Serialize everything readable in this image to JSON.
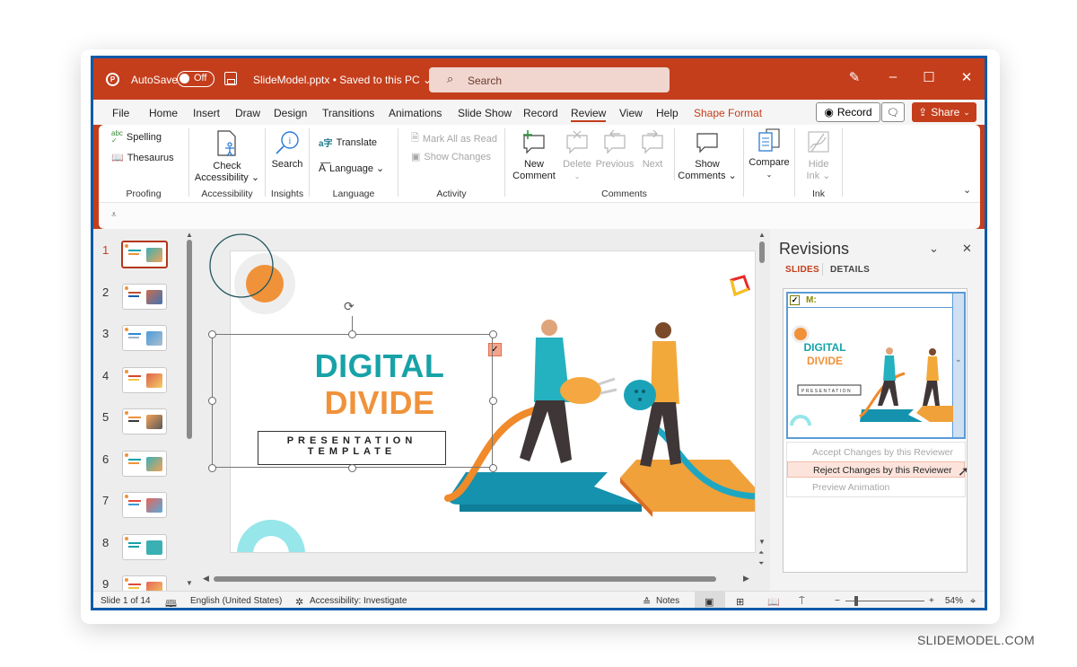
{
  "titlebar": {
    "autosave_label": "AutoSave",
    "autosave_state": "Off",
    "filename": "SlideModel.pptx • Saved to this PC ⌄",
    "search_placeholder": "Search",
    "window_controls": {
      "minimize": "–",
      "maximize": "☐",
      "close": "✕"
    }
  },
  "tabs": [
    "File",
    "Home",
    "Insert",
    "Draw",
    "Design",
    "Transitions",
    "Animations",
    "Slide Show",
    "Record",
    "Review",
    "View",
    "Help",
    "Shape Format"
  ],
  "active_tab": "Review",
  "header_buttons": {
    "record": "Record",
    "share": "Share"
  },
  "ribbon": {
    "proofing": {
      "label": "Proofing",
      "spelling": "Spelling",
      "thesaurus": "Thesaurus"
    },
    "accessibility": {
      "label": "Accessibility",
      "check_line1": "Check",
      "check_line2": "Accessibility ⌄"
    },
    "insights": {
      "label": "Insights",
      "search": "Search"
    },
    "language": {
      "label": "Language",
      "translate": "Translate",
      "language": "Language ⌄"
    },
    "activity": {
      "label": "Activity",
      "mark_all": "Mark All as Read",
      "show_changes": "Show Changes"
    },
    "comments": {
      "label": "Comments",
      "new_line1": "New",
      "new_line2": "Comment",
      "delete": "Delete",
      "previous": "Previous",
      "next": "Next",
      "show_line1": "Show",
      "show_line2": "Comments ⌄"
    },
    "compare": {
      "label": "",
      "compare": "Compare"
    },
    "ink": {
      "label": "Ink",
      "hide_line1": "Hide",
      "hide_line2": "Ink ⌄"
    }
  },
  "slides": {
    "numbers": [
      "1",
      "2",
      "3",
      "4",
      "5",
      "6",
      "7",
      "8",
      "9"
    ],
    "active": "1"
  },
  "slide_content": {
    "title_line1": "DIGITAL",
    "title_line2": "DIVIDE",
    "subtitle_line1": "PRESENTATION",
    "subtitle_line2": "TEMPLATE",
    "colors": {
      "teal": "#17a2a8",
      "orange": "#f0923a"
    }
  },
  "revisions": {
    "title": "Revisions",
    "tab_slides": "SLIDES",
    "tab_details": "DETAILS",
    "reviewer": "M:",
    "thumb_line1": "DIGITAL",
    "thumb_line2": "DIVIDE",
    "menu": {
      "accept": "Accept Changes by this Reviewer",
      "reject": "Reject Changes by this Reviewer",
      "preview": "Preview Animation"
    }
  },
  "status": {
    "slide_info": "Slide 1 of 14",
    "language": "English (United States)",
    "accessibility": "Accessibility: Investigate",
    "notes": "Notes",
    "zoom": "54%"
  },
  "watermark": "SLIDEMODEL.COM"
}
